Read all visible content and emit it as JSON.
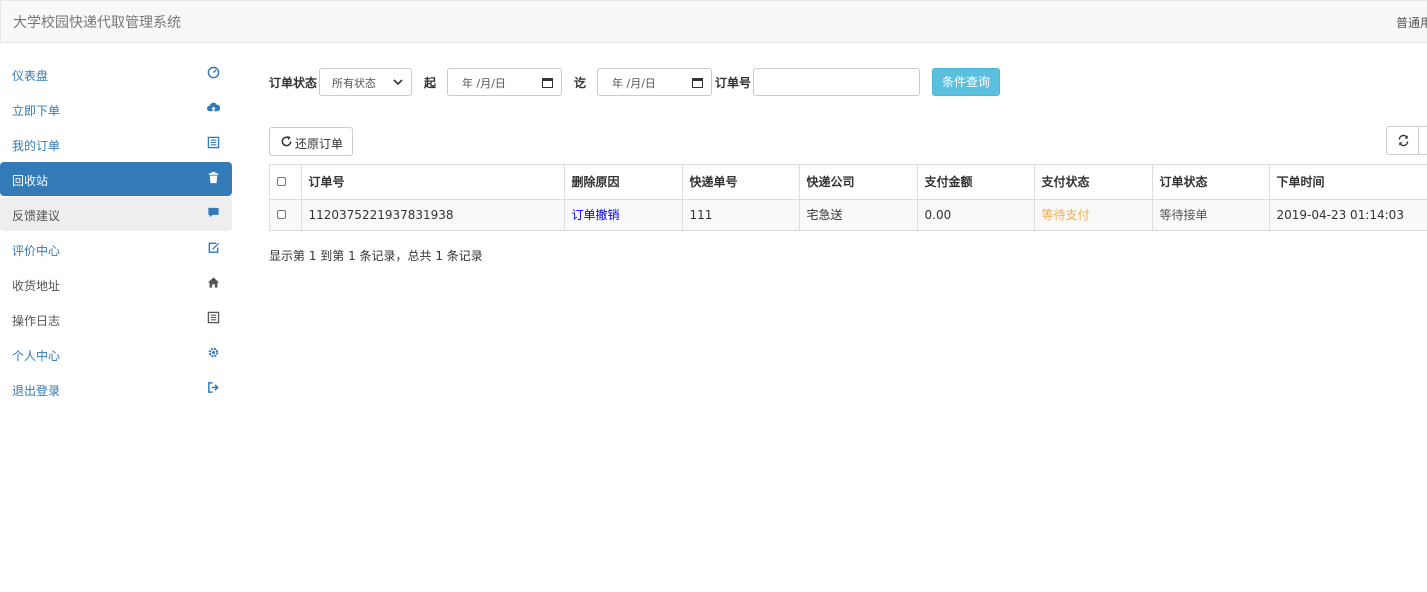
{
  "app": {
    "title": "大学校园快递代取管理系统",
    "user_label": "普通用户"
  },
  "sidebar": {
    "items": [
      {
        "label": "仪表盘",
        "icon": "dashboard-icon"
      },
      {
        "label": "立即下单",
        "icon": "cloud-upload-icon"
      },
      {
        "label": "我的订单",
        "icon": "list-icon"
      },
      {
        "label": "回收站",
        "icon": "trash-icon",
        "active": true
      },
      {
        "label": "反馈建议",
        "icon": "comment-icon"
      },
      {
        "label": "评价中心",
        "icon": "edit-icon"
      },
      {
        "label": "收货地址",
        "icon": "home-icon"
      },
      {
        "label": "操作日志",
        "icon": "list-icon"
      },
      {
        "label": "个人中心",
        "icon": "gear-icon"
      },
      {
        "label": "退出登录",
        "icon": "logout-icon"
      }
    ]
  },
  "filter": {
    "order_status_label": "订单状态",
    "order_status_value": "所有状态",
    "start_label": "起",
    "start_value": "年 /月/日",
    "end_label": "讫",
    "end_value": "年 /月/日",
    "order_no_label": "订单号",
    "order_no_value": "",
    "query_button": "条件查询"
  },
  "toolbar": {
    "restore_button": "还原订单"
  },
  "table": {
    "headers": [
      "订单号",
      "删除原因",
      "快递单号",
      "快递公司",
      "支付金额",
      "支付状态",
      "订单状态",
      "下单时间"
    ],
    "rows": [
      {
        "order_no": "1120375221937831938",
        "delete_reason": "订单撤销",
        "tracking_no": "111",
        "courier": "宅急送",
        "amount": "0.00",
        "pay_status": "等待支付",
        "order_status": "等待接单",
        "created_at": "2019-04-23 01:14:03"
      }
    ]
  },
  "summary": "显示第 1 到第 1 条记录，总共 1 条记录",
  "colors": {
    "primary": "#337ab7",
    "info": "#5bc0de",
    "warning": "#f0ad4e",
    "link": "#0000ee"
  }
}
